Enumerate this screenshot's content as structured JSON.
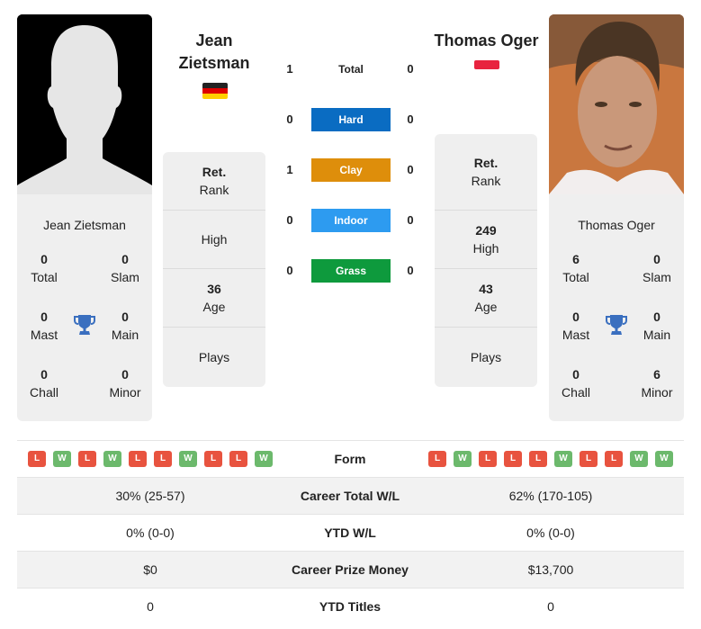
{
  "player1": {
    "name": "Jean Zietsman",
    "name_line1": "Jean",
    "name_line2": "Zietsman",
    "country_flag": "germany-flag",
    "flag_colors": [
      "#000000",
      "#dd0000",
      "#ffce00"
    ],
    "photo": "silhouette-placeholder",
    "titles": {
      "total": {
        "value": "0",
        "label": "Total"
      },
      "slam": {
        "value": "0",
        "label": "Slam"
      },
      "mast": {
        "value": "0",
        "label": "Mast"
      },
      "main": {
        "value": "0",
        "label": "Main"
      },
      "chall": {
        "value": "0",
        "label": "Chall"
      },
      "minor": {
        "value": "0",
        "label": "Minor"
      }
    },
    "info": {
      "rank_value": "Ret.",
      "rank_label": "Rank",
      "high_value": "",
      "high_label": "High",
      "age_value": "36",
      "age_label": "Age",
      "plays_value": "",
      "plays_label": "Plays"
    },
    "form": [
      "L",
      "W",
      "L",
      "W",
      "L",
      "L",
      "W",
      "L",
      "L",
      "W"
    ]
  },
  "player2": {
    "name": "Thomas Oger",
    "country_flag": "monaco-flag",
    "flag_colors": [
      "#e8233f",
      "#ffffff"
    ],
    "photo": "player-photo",
    "titles": {
      "total": {
        "value": "6",
        "label": "Total"
      },
      "slam": {
        "value": "0",
        "label": "Slam"
      },
      "mast": {
        "value": "0",
        "label": "Mast"
      },
      "main": {
        "value": "0",
        "label": "Main"
      },
      "chall": {
        "value": "0",
        "label": "Chall"
      },
      "minor": {
        "value": "6",
        "label": "Minor"
      }
    },
    "info": {
      "rank_value": "Ret.",
      "rank_label": "Rank",
      "high_value": "249",
      "high_label": "High",
      "age_value": "43",
      "age_label": "Age",
      "plays_value": "",
      "plays_label": "Plays"
    },
    "form": [
      "L",
      "W",
      "L",
      "L",
      "L",
      "W",
      "L",
      "L",
      "W",
      "W"
    ]
  },
  "h2h": [
    {
      "label": "Total",
      "p1": "1",
      "p2": "0",
      "color": null
    },
    {
      "label": "Hard",
      "p1": "0",
      "p2": "0",
      "color": "#0a6cc2"
    },
    {
      "label": "Clay",
      "p1": "1",
      "p2": "0",
      "color": "#de8e0b"
    },
    {
      "label": "Indoor",
      "p1": "0",
      "p2": "0",
      "color": "#2d9bf0"
    },
    {
      "label": "Grass",
      "p1": "0",
      "p2": "0",
      "color": "#0e9a3d"
    }
  ],
  "form_label": "Form",
  "stats": [
    {
      "label": "Career Total W/L",
      "p1": "30% (25-57)",
      "p2": "62% (170-105)"
    },
    {
      "label": "YTD W/L",
      "p1": "0% (0-0)",
      "p2": "0% (0-0)"
    },
    {
      "label": "Career Prize Money",
      "p1": "$0",
      "p2": "$13,700"
    },
    {
      "label": "YTD Titles",
      "p1": "0",
      "p2": "0"
    }
  ],
  "colors": {
    "loss": "#e8533f",
    "win": "#6cb96c",
    "trophy": "#3a6fbf"
  }
}
